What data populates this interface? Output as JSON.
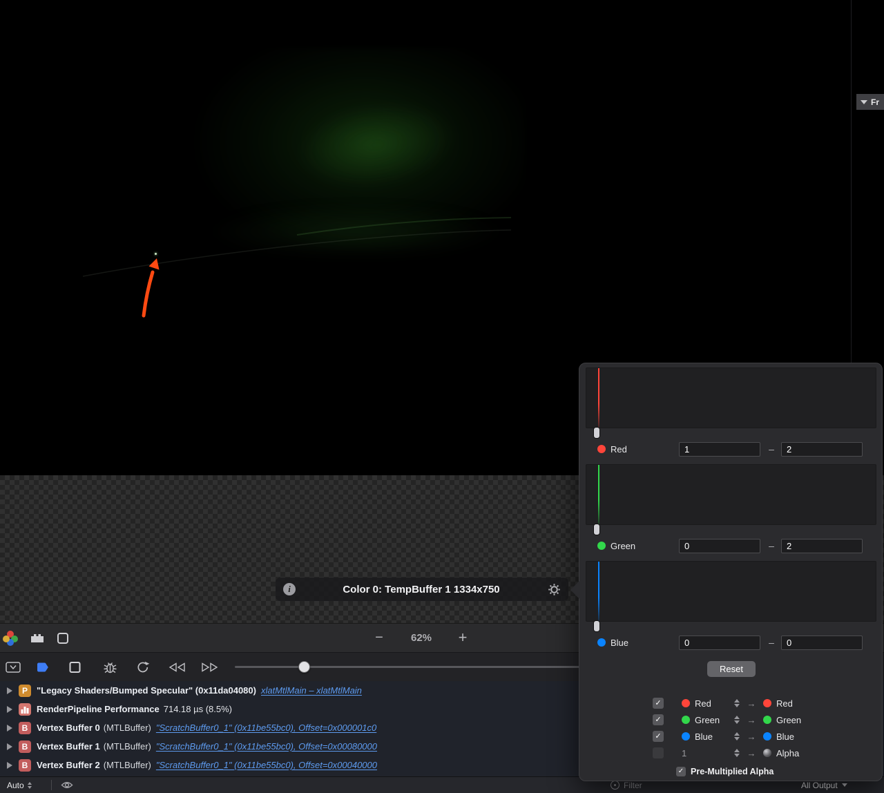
{
  "icons": {
    "check": "✓",
    "info": "i",
    "zoom_out": "−",
    "zoom_in": "+",
    "range_dash": "–",
    "map_arrow": "→"
  },
  "viewport": {
    "attachment_label": "Color 0: TempBuffer 1 1334x750"
  },
  "right_panel": {
    "header_text": "Fr"
  },
  "popover": {
    "channels": [
      {
        "name": "Red",
        "color": "#ff453a",
        "min": "1",
        "max": "2"
      },
      {
        "name": "Green",
        "color": "#32d74b",
        "min": "0",
        "max": "2"
      },
      {
        "name": "Blue",
        "color": "#0a84ff",
        "min": "0",
        "max": "0"
      }
    ],
    "reset_label": "Reset",
    "mappings": [
      {
        "checked": true,
        "source": "Red",
        "source_color": "#ff453a",
        "target": "Red",
        "target_color": "#ff453a"
      },
      {
        "checked": true,
        "source": "Green",
        "source_color": "#32d74b",
        "target": "Green",
        "target_color": "#32d74b"
      },
      {
        "checked": true,
        "source": "Blue",
        "source_color": "#0a84ff",
        "target": "Blue",
        "target_color": "#0a84ff"
      },
      {
        "checked": false,
        "source": "1",
        "source_color": "",
        "target": "Alpha",
        "target_color": "#8e8e93"
      }
    ],
    "premultiplied": {
      "label": "Pre-Multiplied Alpha",
      "checked": true
    }
  },
  "zoom_toolbar": {
    "zoom_level": "62%"
  },
  "debug_list": {
    "rows": [
      {
        "badge": "P",
        "title": "\"Legacy Shaders/Bumped Specular\" (0x11da04080)",
        "link": "xlatMtlMain – xlatMtlMain"
      },
      {
        "badge": "chart",
        "title": "RenderPipeline Performance",
        "detail": "714.18 µs (8.5%)"
      },
      {
        "badge": "B",
        "title": "Vertex Buffer 0",
        "kind": "(MTLBuffer)",
        "link": "\"ScratchBuffer0_1\" (0x11be55bc0), Offset=0x000001c0"
      },
      {
        "badge": "B",
        "title": "Vertex Buffer 1",
        "kind": "(MTLBuffer)",
        "link": "\"ScratchBuffer0_1\" (0x11be55bc0), Offset=0x00080000"
      },
      {
        "badge": "B",
        "title": "Vertex Buffer 2",
        "kind": "(MTLBuffer)",
        "link": "\"ScratchBuffer0_1\" (0x11be55bc0), Offset=0x00040000"
      }
    ]
  },
  "bottom_bar": {
    "auto_label": "Auto",
    "filter_label": "Filter",
    "output_selector": "All Output"
  }
}
